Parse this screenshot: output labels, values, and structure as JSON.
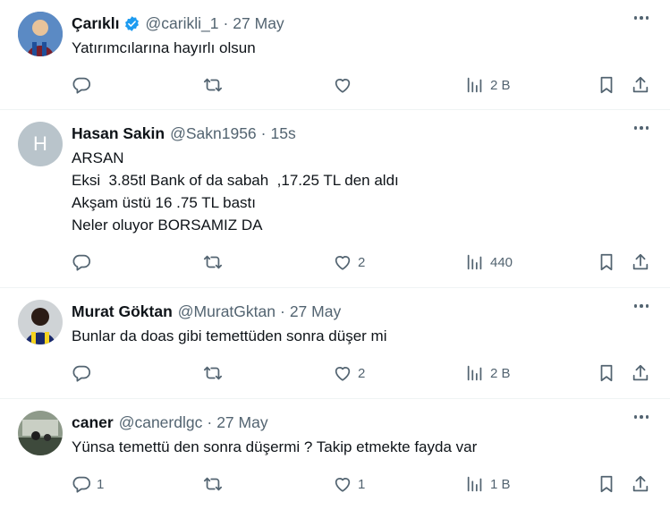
{
  "colors": {
    "text": "#0f1419",
    "muted": "#536471",
    "verified": "#1d9bf0",
    "divider": "#eff3f4"
  },
  "icons": {
    "reply": "reply-icon",
    "retweet": "retweet-icon",
    "like": "heart-icon",
    "views": "views-bar-icon",
    "bookmark": "bookmark-icon",
    "share": "share-icon",
    "more": "more-dots-icon",
    "verified": "verified-badge-icon"
  },
  "tweets": [
    {
      "name": "Çarıklı",
      "verified": true,
      "handle": "@carikli_1",
      "separator": "·",
      "time": "27 May",
      "body": "Yatırımcılarına hayırlı olsun",
      "counts": {
        "reply": "",
        "retweet": "",
        "like": "",
        "views": "2 B"
      }
    },
    {
      "name": "Hasan Sakin",
      "verified": false,
      "handle": "@Sakn1956",
      "separator": "·",
      "time": "15s",
      "avatar_letter": "H",
      "body": "ARSAN\nEksi  3.85tl Bank of da sabah  ,17.25 TL den aldı\nAkşam üstü 16 .75 TL bastı\nNeler oluyor BORSAMIZ DA",
      "counts": {
        "reply": "",
        "retweet": "",
        "like": "2",
        "views": "440"
      }
    },
    {
      "name": "Murat Göktan",
      "verified": false,
      "handle": "@MuratGktan",
      "separator": "·",
      "time": "27 May",
      "body": "Bunlar da doas gibi temettüden sonra düşer mi",
      "counts": {
        "reply": "",
        "retweet": "",
        "like": "2",
        "views": "2 B"
      }
    },
    {
      "name": "caner",
      "verified": false,
      "handle": "@canerdlgc",
      "separator": "·",
      "time": "27 May",
      "body": "Yünsa temettü den sonra düşermi ? Takip etmekte fayda var",
      "counts": {
        "reply": "1",
        "retweet": "",
        "like": "1",
        "views": "1 B"
      }
    }
  ]
}
